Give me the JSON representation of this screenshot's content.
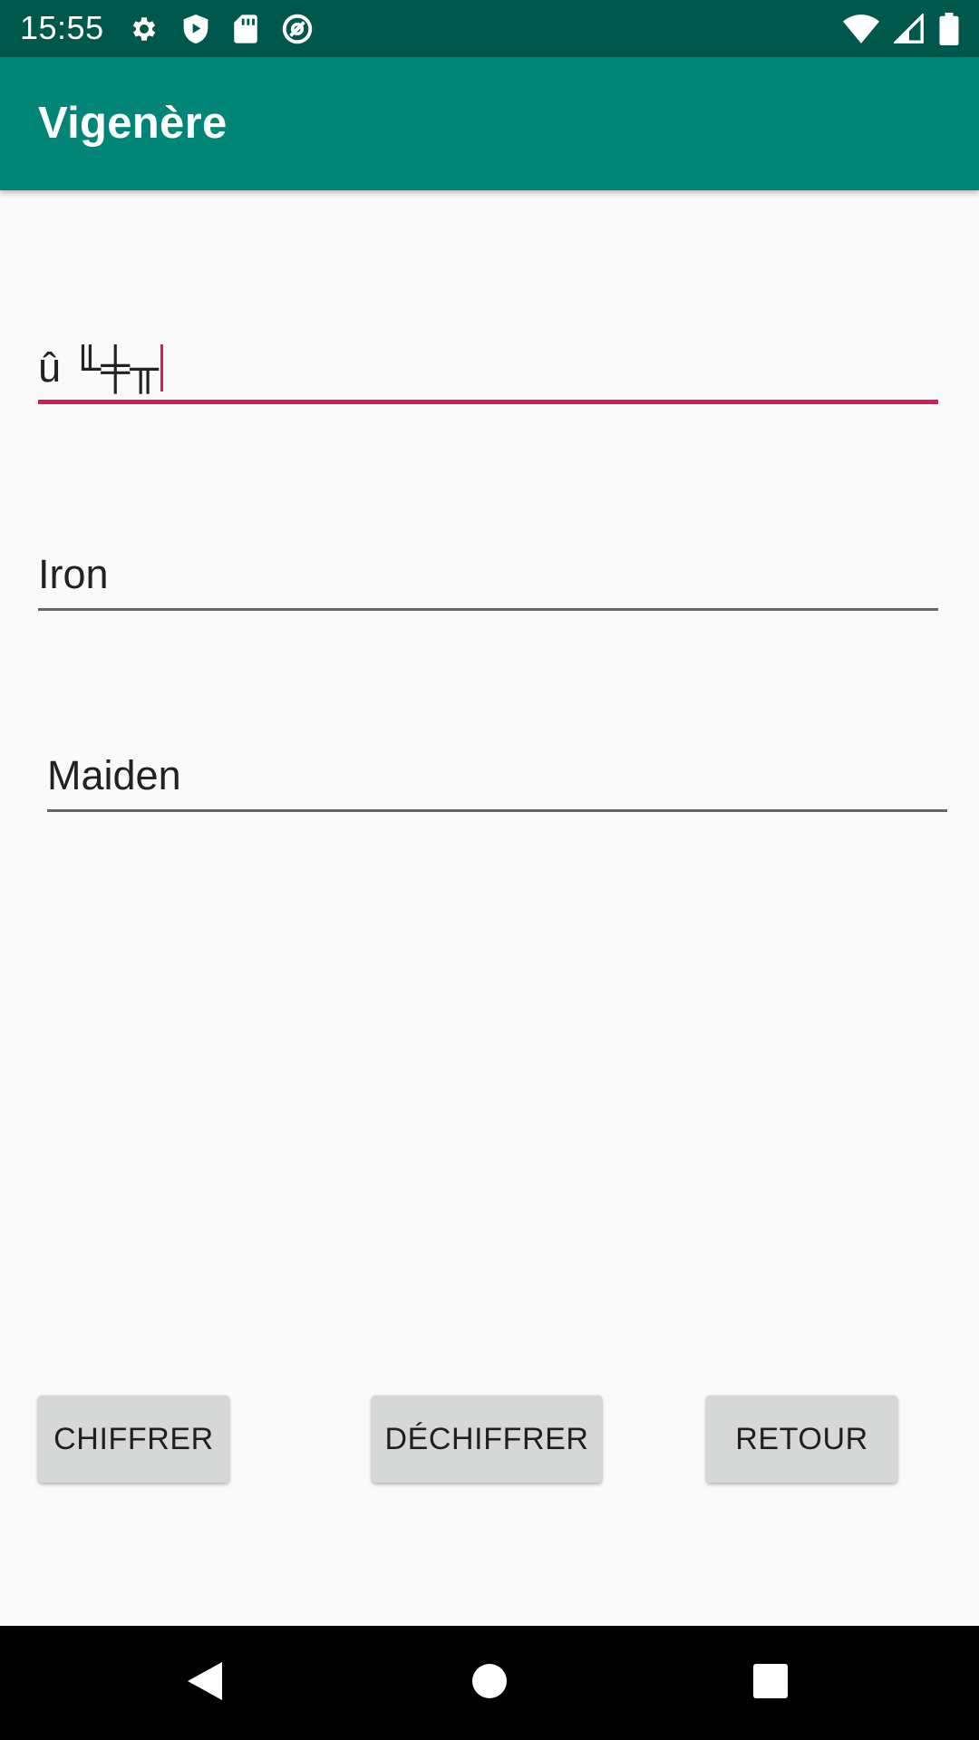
{
  "status_bar": {
    "time": "15:55",
    "background": "#00574b",
    "left_icons": [
      "settings-icon",
      "shield-play-icon",
      "sd-card-icon",
      "at-sign-icon"
    ],
    "right_icons": [
      "wifi-icon",
      "signal-icon",
      "battery-icon"
    ]
  },
  "app_bar": {
    "title": "Vigenère",
    "background": "#008577"
  },
  "fields": {
    "cipher_text": {
      "value": "û ╙╪╥"
    },
    "key": {
      "value": "Iron"
    },
    "plain_text": {
      "value": "Maiden"
    }
  },
  "buttons": {
    "encrypt_label": "CHIFFRER",
    "decrypt_label": "DÉCHIFFRER",
    "back_label": "RETOUR"
  },
  "nav_bar": {
    "icons": [
      "back-icon",
      "home-icon",
      "recents-icon"
    ]
  },
  "colors": {
    "accent": "#d81b60",
    "primary": "#008577",
    "primary_dark": "#00574b",
    "button_bg": "#d6d7d7"
  }
}
